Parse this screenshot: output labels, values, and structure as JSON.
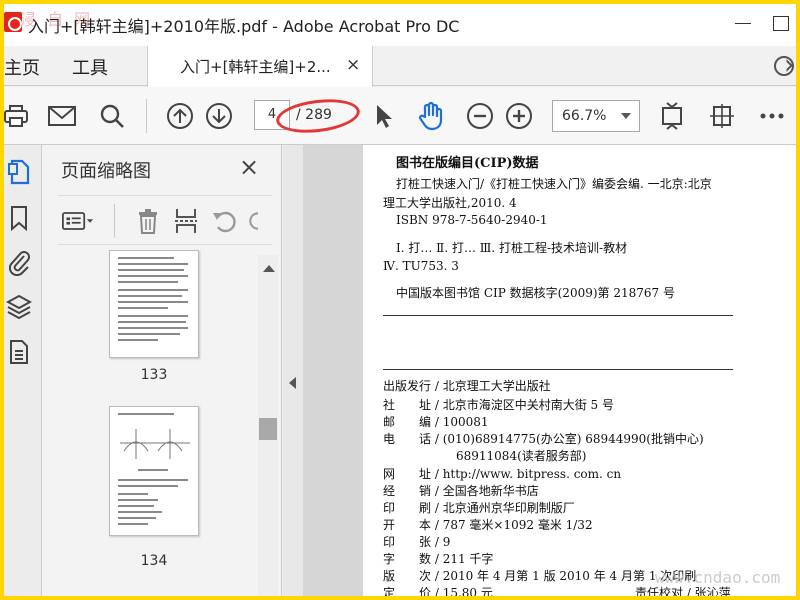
{
  "window": {
    "title": "入门+[韩轩主编]+2010年版.pdf - Adobe Acrobat Pro DC",
    "watermark_tl": "浸 自 网"
  },
  "tabs": {
    "home": "主页",
    "tools": "工具",
    "document": "入门+[韩轩主编]+2...",
    "close": "×"
  },
  "toolbar": {
    "page_current": "4",
    "page_total": "/ 289",
    "zoom": "66.7%"
  },
  "panel": {
    "title": "页面缩略图",
    "close": "×",
    "thumbnails": [
      {
        "label": "133"
      },
      {
        "label": "134"
      }
    ]
  },
  "pdf": {
    "heading": "图书在版编目(CIP)数据",
    "cip_line1": "打桩工快速入门/《打桩工快速入门》编委会编. 一北京:北京",
    "cip_line2": "理工大学出版社,2010. 4",
    "isbn": "ISBN 978-7-5640-2940-1",
    "class_line": "Ⅰ. 打…  Ⅱ. 打…  Ⅲ. 打桩工程-技术培训-教材",
    "class_code": "Ⅳ. TU753. 3",
    "cip_no": "中国版本图书馆 CIP 数据核字(2009)第 218767 号",
    "imprint": [
      {
        "label": "出版发行",
        "value": "北京理工大学出版社"
      },
      {
        "label": "社　　址",
        "value": "北京市海淀区中关村南大街 5 号"
      },
      {
        "label": "邮　　编",
        "value": "100081"
      },
      {
        "label": "电　　话",
        "value": "(010)68914775(办公室)  68944990(批销中心)"
      },
      {
        "label": "",
        "value": "68911084(读者服务部)"
      },
      {
        "label": "网　　址",
        "value": "http://www. bitpress. com. cn"
      },
      {
        "label": "经　　销",
        "value": "全国各地新华书店"
      },
      {
        "label": "印　　刷",
        "value": "北京通州京华印刷制版厂"
      },
      {
        "label": "开　　本",
        "value": "787 毫米×1092 毫米  1/32"
      },
      {
        "label": "印　　张",
        "value": "9"
      },
      {
        "label": "字　　数",
        "value": "211 千字"
      },
      {
        "label": "版　　次",
        "value": "2010 年 4 月第 1 版  2010 年 4 月第 1 次印刷"
      },
      {
        "label": "定　　价",
        "value": "15.80 元"
      }
    ],
    "proofreader": "责任校对 / 张沁萍",
    "watermark_br": "www.cndao.com"
  },
  "colors": {
    "frame": "#ffd600",
    "annotation": "#e53535",
    "accent_blue": "#1e6fd9"
  }
}
